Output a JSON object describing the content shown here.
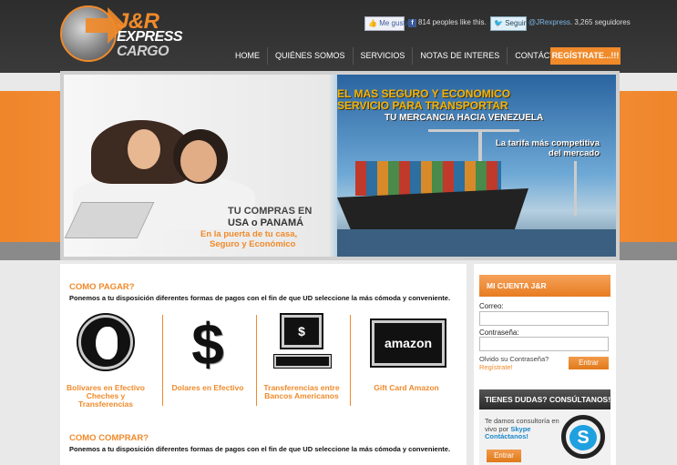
{
  "logo": {
    "line1": "J&R",
    "line2": "EXPRESS",
    "line3": "CARGO"
  },
  "social": {
    "fb_like": "Me gusta",
    "fb_count": "814 peoples like this.",
    "tw_follow": "Seguir",
    "tw_handle": "@JRexpress",
    "tw_count": ". 3,265 seguidores"
  },
  "nav": {
    "items": [
      "HOME",
      "QUIÉNES SOMOS",
      "SERVICIOS",
      "NOTAS DE INTERES",
      "CONTÁCTENOS"
    ],
    "cta": "REGÍSTRATE...!!!"
  },
  "banner": {
    "headline1": "EL MAS SEGURO Y ECONOMICO",
    "headline2": "SERVICIO PARA TRANSPORTAR",
    "sub": "TU MERCANCIA HACIA VENEZUELA",
    "tarifa": "La tarifa más competitiva del mercado",
    "usa1": "TU COMPRAS EN",
    "usa2": "USA o PANAMÁ",
    "orange1": "En la puerta de tu casa,",
    "orange2": "Seguro y Económico"
  },
  "pagar": {
    "title": "COMO PAGAR?",
    "text": "Ponemos a tu disposición diferentes formas de pagos con el fin de que UD seleccione la más cómoda y conveniente.",
    "options": [
      {
        "label": "Bolivares en Efectivo Cheches y Transferencias",
        "icon": "person-head-icon"
      },
      {
        "label": "Dolares en Efectivo",
        "icon": "dollar-icon"
      },
      {
        "label": "Transferencias entre Bancos Americanos",
        "icon": "computer-transfer-icon"
      },
      {
        "label": "Gift Card Amazon",
        "icon": "amazon-icon"
      }
    ],
    "dollar_glyph": "$",
    "monitor_glyph": "$",
    "amazon_text": "amazon"
  },
  "comprar": {
    "title": "COMO COMPRAR?",
    "text": "Ponemos a tu disposición diferentes formas de pagos con el fin de que UD seleccione la más cómoda y conveniente."
  },
  "account": {
    "title": "MI CUENTA  J&R",
    "correo_label": "Correo:",
    "correo_value": "",
    "pass_label": "Contraseña:",
    "pass_value": "",
    "forgot": "Olvido su Contraseña?",
    "register": "Regístrate!",
    "login_btn": "Entrar"
  },
  "help": {
    "title_a": "TIENES DUDAS? ",
    "title_b": "CONSÚLTANOS!",
    "text1": "Te damos consultoría en vivo por ",
    "skype": "Skype",
    "contact": "Contáctanos!",
    "btn": "Entrar",
    "skype_glyph": "S"
  },
  "colors": {
    "accent": "#f08a2a",
    "dark": "#2d2d2d",
    "skype": "#1fa0e0"
  }
}
